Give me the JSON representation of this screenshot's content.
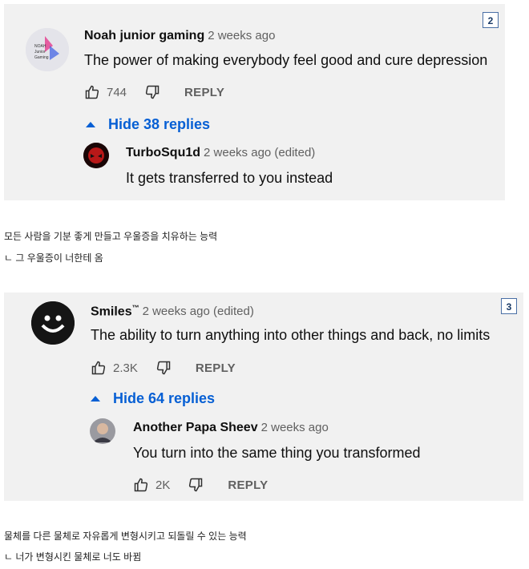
{
  "card1": {
    "badge": "2",
    "comment": {
      "author": "Noah junior gaming",
      "time": "2 weeks ago",
      "text": "The power of making everybody feel good and cure depression",
      "likes": "744",
      "reply_label": "REPLY",
      "avatar_text": "Noah Junior Gaming"
    },
    "hide_replies": "Hide 38 replies",
    "reply": {
      "author": "TurboSqu1d",
      "time": "2 weeks ago (edited)",
      "text": "It gets transferred to you instead"
    }
  },
  "caption1": {
    "line1": "모든 사람을 기분 좋게 만들고 우울증을 치유하는 능력",
    "line2": "ㄴ 그 우울증이 너한테 옴"
  },
  "card2": {
    "badge": "3",
    "comment": {
      "author": "Smiles",
      "author_tm": "™",
      "time": "2 weeks ago (edited)",
      "text": "The ability to turn anything into other things and back, no limits",
      "likes": "2.3K",
      "reply_label": "REPLY"
    },
    "hide_replies": "Hide 64 replies",
    "reply": {
      "author": "Another Papa Sheev",
      "time": "2 weeks ago",
      "text": "You turn into the same thing you transformed",
      "likes": "2K",
      "reply_label": "REPLY"
    }
  },
  "caption2": {
    "line1": "물체를 다른 물체로 자유롭게 변형시키고 되돌릴 수 있는 능력",
    "line2": "ㄴ 너가 변형시킨 물체로 너도 바뀜"
  },
  "colors": {
    "card_bg": "#f1f1f1",
    "link_blue": "#065fd4",
    "muted": "#606060"
  }
}
